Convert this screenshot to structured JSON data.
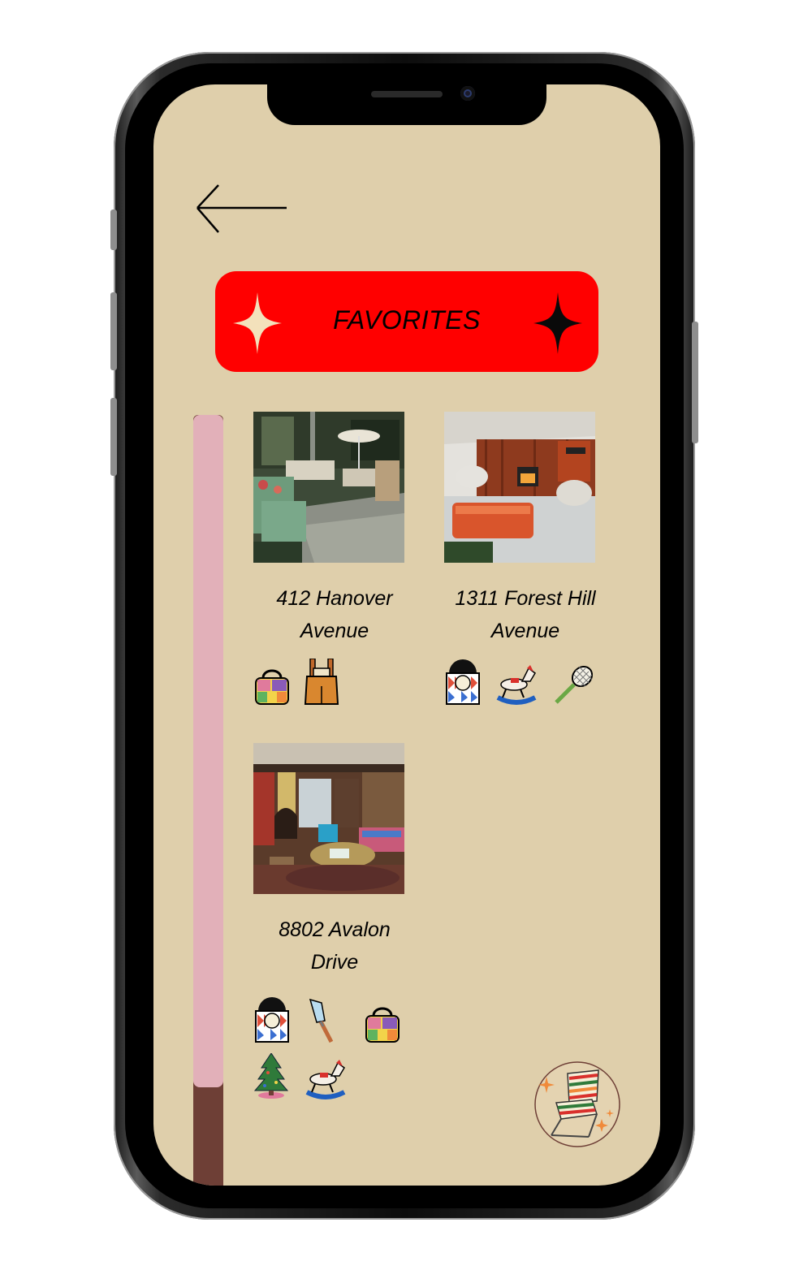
{
  "header": {
    "back_label": "Back",
    "title": "FAVORITES"
  },
  "colors": {
    "screen_bg": "#dfcfab",
    "banner": "#ff0000",
    "scroll_thumb": "#e2b0b9",
    "scroll_track": "#6e3f36"
  },
  "scroll": {
    "position_fraction": 0.86
  },
  "favorites": [
    {
      "address": "412 Hanover Avenue",
      "photo": "sunroom-patio-photo",
      "tags": [
        "patchwork-bag-icon",
        "overalls-icon"
      ]
    },
    {
      "address": "1311 Forest Hill Avenue",
      "photo": "wood-panel-living-room-photo",
      "tags": [
        "vinyl-record-bag-icon",
        "rocking-horse-icon",
        "tennis-racket-icon"
      ]
    },
    {
      "address": "8802 Avalon Drive",
      "photo": "retro-fireplace-living-room-photo",
      "tags": [
        "vinyl-record-bag-icon",
        "trowel-icon",
        "patchwork-bag-icon",
        "christmas-tree-icon",
        "rocking-horse-icon"
      ]
    }
  ],
  "badge": {
    "icon": "lawn-chair-icon"
  }
}
